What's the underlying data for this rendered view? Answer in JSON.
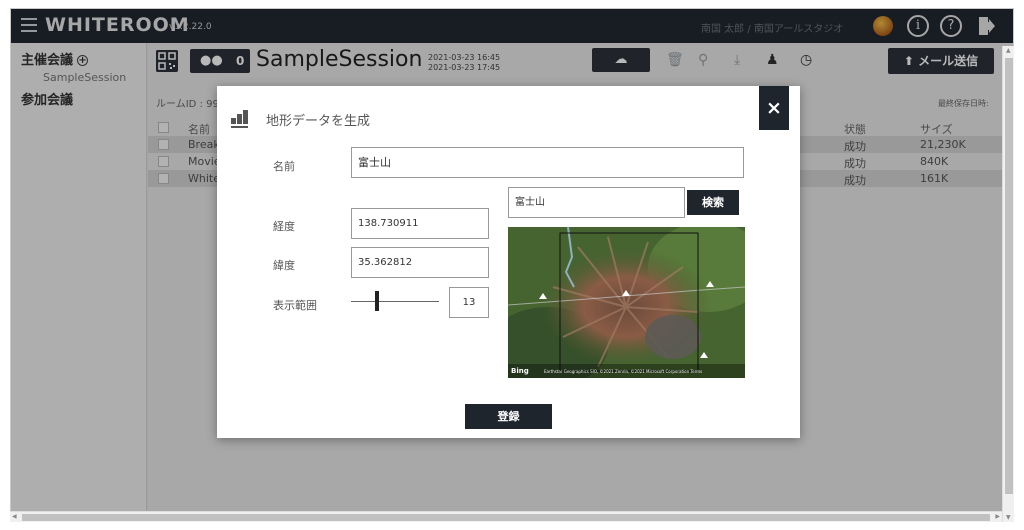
{
  "app": {
    "logo": "WHITEROOM",
    "version": "v1.2.22.0",
    "user": "南国 太郎 / 南国アールスタジオ",
    "info_icon": "info-icon",
    "help_glyph": "?",
    "info_glyph": "i"
  },
  "sidebar": {
    "hosted_label": "主催会議",
    "hosted_items": [
      "SampleSession"
    ],
    "joined_label": "参加会議"
  },
  "session": {
    "participants": "0",
    "name": "SampleSession",
    "start": "2021-03-23 16:45",
    "end": "2021-03-23 17:45",
    "room_id": "ルームID : 99",
    "last_saved": "最終保存日時:",
    "mail_button": "メール送信"
  },
  "table": {
    "headers": {
      "name": "名前",
      "status": "状態",
      "size": "サイズ"
    },
    "rows": [
      {
        "name": "Breaker",
        "status": "成功",
        "size": "21,230K"
      },
      {
        "name": "Movie0",
        "status": "成功",
        "size": "840K"
      },
      {
        "name": "Whiter",
        "status": "成功",
        "size": "161K"
      }
    ]
  },
  "modal": {
    "title": "地形データを生成",
    "close": "×",
    "name_label": "名前",
    "name_value": "富士山",
    "search_value": "富士山",
    "search_button": "検索",
    "longitude_label": "経度",
    "longitude_value": "138.730911",
    "latitude_label": "緯度",
    "latitude_value": "35.362812",
    "range_label": "表示範囲",
    "range_value": "13",
    "range_fraction": 0.3,
    "map_bing": "Bing",
    "map_copyright": "Earthstar Geographics SIO, ©2021 Zenrin, ©2021 Microsoft Corporation Terms",
    "register_button": "登録"
  }
}
